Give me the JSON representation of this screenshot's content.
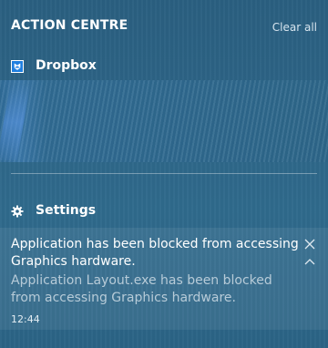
{
  "header": {
    "title": "ACTION CENTRE",
    "clear_all_label": "Clear all"
  },
  "groups": [
    {
      "app_name": "Dropbox",
      "icon": "dropbox-icon"
    },
    {
      "app_name": "Settings",
      "icon": "gear-icon",
      "notification": {
        "title": "Application has been blocked from accessing Graphics hardware.",
        "body": "Application Layout.exe has been blocked from accessing Graphics hardware.",
        "time": "12:44"
      }
    }
  ],
  "colors": {
    "panel_bg": "#2d6486",
    "secondary_text": "#b7cbd8",
    "dropbox_blue": "#1f7fe0"
  }
}
